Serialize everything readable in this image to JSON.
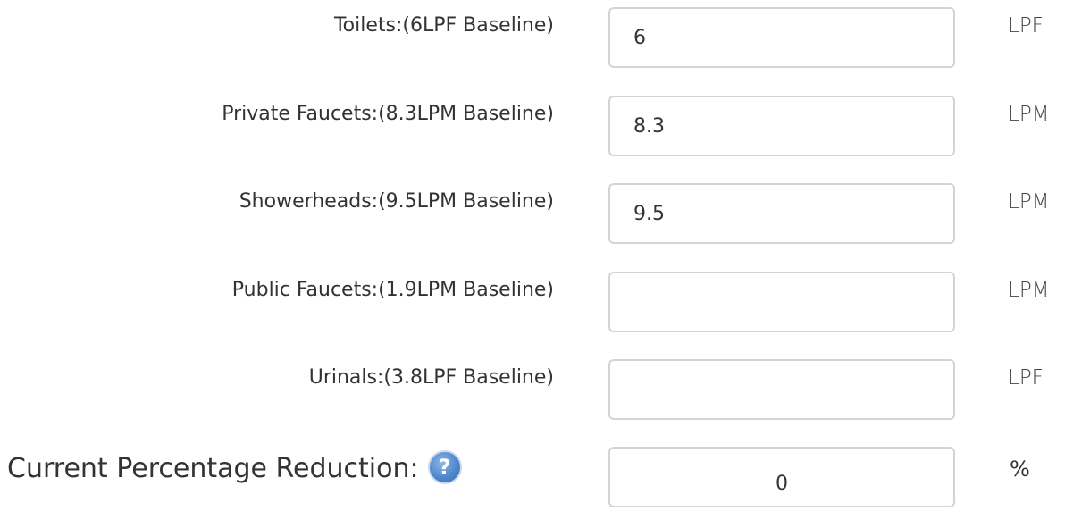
{
  "fixtures": [
    {
      "label": "Toilets:(6LPF Baseline)",
      "value": "6",
      "unit": "LPF"
    },
    {
      "label": "Private Faucets:(8.3LPM Baseline)",
      "value": "8.3",
      "unit": "LPM"
    },
    {
      "label": "Showerheads:(9.5LPM Baseline)",
      "value": "9.5",
      "unit": "LPM"
    },
    {
      "label": "Public Faucets:(1.9LPM Baseline)",
      "value": "",
      "unit": "LPM"
    },
    {
      "label": "Urinals:(3.8LPF Baseline)",
      "value": "",
      "unit": "LPF"
    }
  ],
  "summary": {
    "label": "Current Percentage Reduction:",
    "help_icon": "question-icon",
    "help_glyph": "?",
    "value": "0",
    "unit": "%"
  }
}
